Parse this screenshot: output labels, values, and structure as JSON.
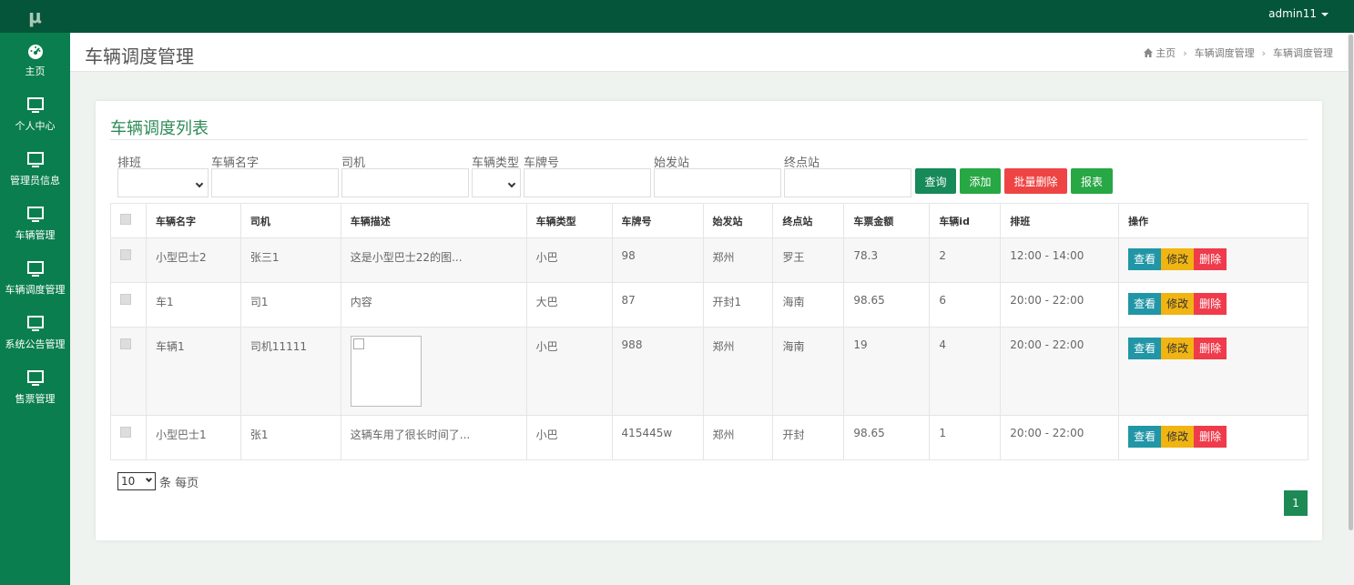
{
  "brand": {
    "logo_text": "μ"
  },
  "topbar": {
    "user": "admin11"
  },
  "sidebar": {
    "items": [
      {
        "label": "主页",
        "icon": "dashboard-icon"
      },
      {
        "label": "个人中心",
        "icon": "monitor-icon"
      },
      {
        "label": "管理员信息",
        "icon": "monitor-icon"
      },
      {
        "label": "车辆管理",
        "icon": "monitor-icon"
      },
      {
        "label": "车辆调度管理",
        "icon": "monitor-icon"
      },
      {
        "label": "系统公告管理",
        "icon": "monitor-icon"
      },
      {
        "label": "售票管理",
        "icon": "monitor-icon"
      }
    ]
  },
  "header": {
    "title": "车辆调度管理",
    "breadcrumb": [
      "主页",
      "车辆调度管理",
      "车辆调度管理"
    ]
  },
  "card": {
    "title": "车辆调度列表"
  },
  "filters": {
    "schedule": "排班",
    "vehicle_name": "车辆名字",
    "driver": "司机",
    "vehicle_type": "车辆类型",
    "plate": "车牌号",
    "origin": "始发站",
    "destination": "终点站"
  },
  "buttons": {
    "query": "查询",
    "add": "添加",
    "batch_delete": "批量删除",
    "report": "报表"
  },
  "table": {
    "headers": [
      "车辆名字",
      "司机",
      "车辆描述",
      "车辆类型",
      "车牌号",
      "始发站",
      "终点站",
      "车票金额",
      "车辆id",
      "排班",
      "操作"
    ],
    "rows": [
      {
        "name": "小型巴士2",
        "driver": "张三1",
        "desc": "这是小型巴士22的图...",
        "type": "小巴",
        "plate": "98",
        "origin": "郑州",
        "dest": "罗王",
        "price": "78.3",
        "id": "2",
        "schedule": "12:00 - 14:00"
      },
      {
        "name": "车1",
        "driver": "司1",
        "desc": "内容",
        "type": "大巴",
        "plate": "87",
        "origin": "开封1",
        "dest": "海南",
        "price": "98.65",
        "id": "6",
        "schedule": "20:00 - 22:00"
      },
      {
        "name": "车辆1",
        "driver": "司机11111",
        "desc": "",
        "type": "小巴",
        "plate": "988",
        "origin": "郑州",
        "dest": "海南",
        "price": "19",
        "id": "4",
        "schedule": "20:00 - 22:00"
      },
      {
        "name": "小型巴士1",
        "driver": "张1",
        "desc": "这辆车用了很长时间了...",
        "type": "小巴",
        "plate": "415445w",
        "origin": "郑州",
        "dest": "开封",
        "price": "98.65",
        "id": "1",
        "schedule": "20:00 - 22:00"
      }
    ],
    "actions": {
      "view": "查看",
      "edit": "修改",
      "delete": "删除"
    }
  },
  "pagination": {
    "page_size": "10",
    "page_size_suffix": "条 每页",
    "current_page": "1"
  },
  "colors": {
    "topbar": "#04553a",
    "sidebar": "#0a7e4e",
    "accent": "#2e8b57"
  }
}
